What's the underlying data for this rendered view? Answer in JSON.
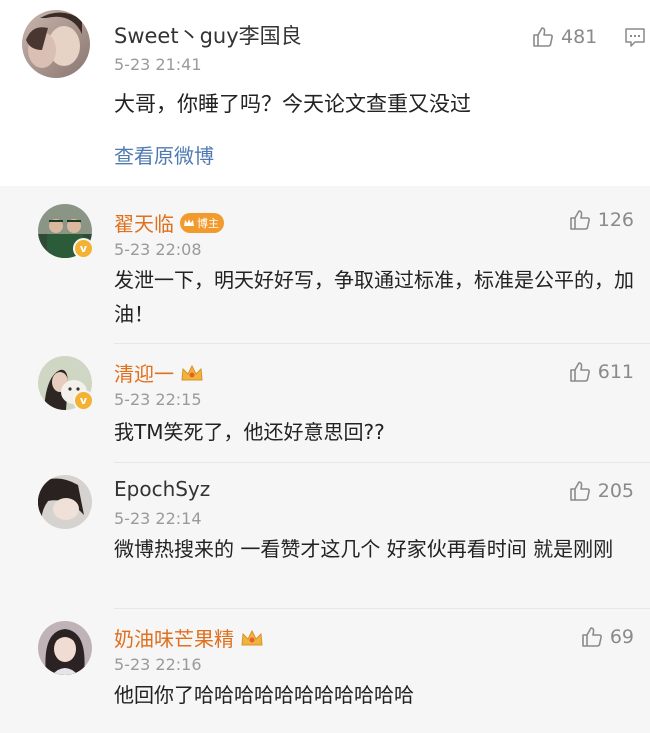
{
  "post": {
    "username": "Sweet丶guy李国良",
    "time": "5-23 21:41",
    "text": "大哥，你睡了吗？今天论文查重又没过",
    "view_original": "查看原微博",
    "likes": "481"
  },
  "comments": [
    {
      "username": "翟天临",
      "badge": "博主",
      "time": "5-23 22:08",
      "text": "发泄一下，明天好好写，争取通过标准，标准是公平的，加油！",
      "likes": "126"
    },
    {
      "username": "清迎一",
      "time": "5-23 22:15",
      "text": "我TM笑死了，他还好意思回??",
      "likes": "611"
    },
    {
      "username": "EpochSyz",
      "time": "5-23 22:14",
      "text": "微博热搜来的 一看赞才这几个 好家伙再看时间 就是刚刚",
      "likes": "205"
    },
    {
      "username": "奶油味芒果精",
      "time": "5-23 22:16",
      "text": "他回你了哈哈哈哈哈哈哈哈哈哈哈",
      "likes": "69"
    }
  ]
}
